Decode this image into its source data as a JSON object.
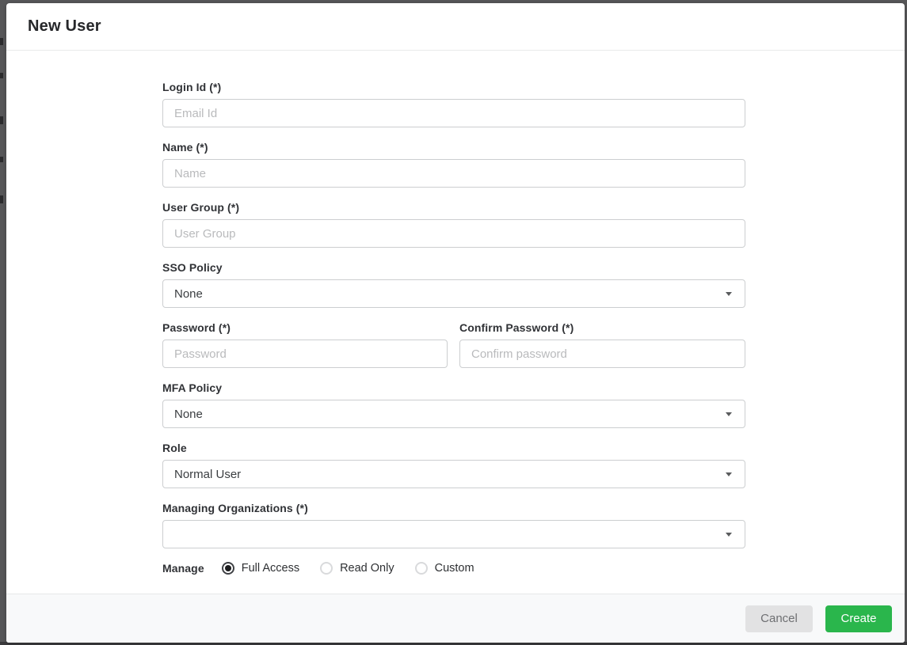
{
  "modal": {
    "title": "New User"
  },
  "form": {
    "login": {
      "label": "Login Id (*)",
      "placeholder": "Email Id",
      "value": ""
    },
    "name": {
      "label": "Name (*)",
      "placeholder": "Name",
      "value": ""
    },
    "user_group": {
      "label": "User Group (*)",
      "placeholder": "User Group",
      "value": ""
    },
    "sso_policy": {
      "label": "SSO Policy",
      "value": "None"
    },
    "password": {
      "label": "Password (*)",
      "placeholder": "Password",
      "value": ""
    },
    "confirm_password": {
      "label": "Confirm Password (*)",
      "placeholder": "Confirm password",
      "value": ""
    },
    "mfa_policy": {
      "label": "MFA Policy",
      "value": "None"
    },
    "role": {
      "label": "Role",
      "value": "Normal User"
    },
    "managing_organizations": {
      "label": "Managing Organizations (*)",
      "value": ""
    },
    "manage": {
      "label": "Manage",
      "options": [
        {
          "label": "Full Access",
          "selected": true
        },
        {
          "label": "Read Only",
          "selected": false
        },
        {
          "label": "Custom",
          "selected": false
        }
      ]
    }
  },
  "footer": {
    "cancel_label": "Cancel",
    "create_label": "Create"
  },
  "icons": {
    "select_caret": "chevron-down"
  },
  "colors": {
    "create_button": "#2ab64c",
    "cancel_button": "#e2e2e3",
    "overlay_frame": "#565658",
    "footer_background": "#f8f9fa",
    "input_border": "#ccced0",
    "placeholder_text": "#b9babc"
  }
}
